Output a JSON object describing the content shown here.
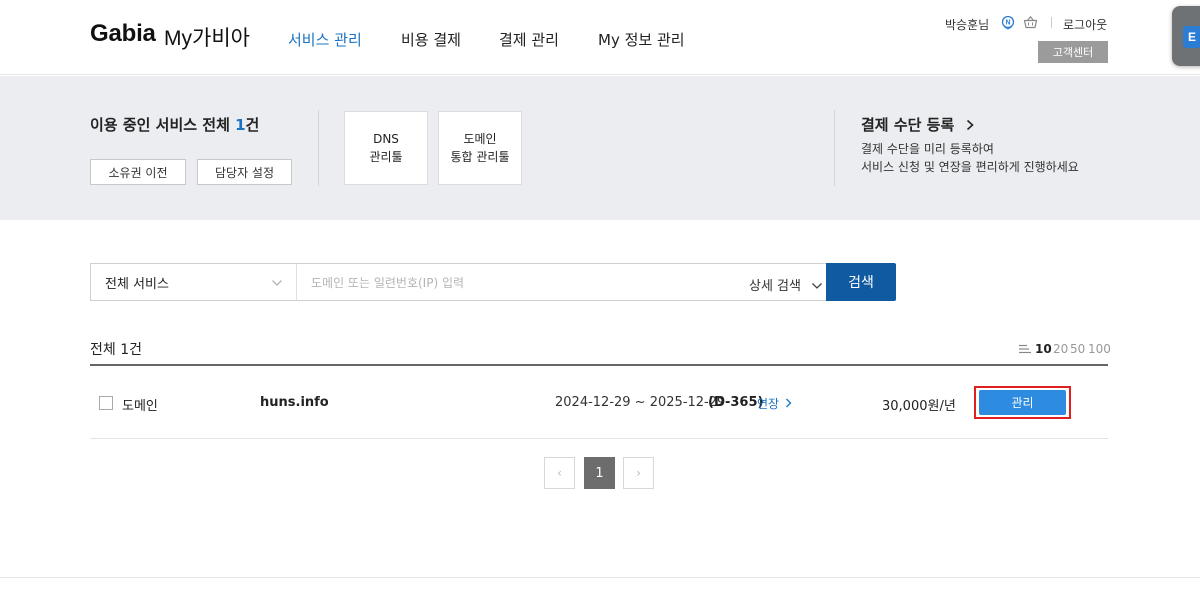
{
  "header": {
    "logo": "Gabia",
    "logo_sub": "My가비아",
    "nav": [
      {
        "label": "서비스 관리",
        "active": true
      },
      {
        "label": "비용 결제",
        "active": false
      },
      {
        "label": "결제 관리",
        "active": false
      },
      {
        "label": "My 정보 관리",
        "active": false
      }
    ],
    "user_name": "박승훈님",
    "notification_icon": "n-badge-icon",
    "cart_icon": "basket-icon",
    "logout_label": "로그아웃",
    "support_label": "고객센터",
    "side_app_letter": "E"
  },
  "summary": {
    "title_prefix": "이용 중인 서비스 전체 ",
    "title_count": "1",
    "title_suffix": "건",
    "transfer_button": "소유권 이전",
    "manager_button": "담당자 설정",
    "tools": [
      {
        "line1": "DNS",
        "line2": "관리툴"
      },
      {
        "line1": "도메인",
        "line2": "통합 관리툴"
      }
    ],
    "payment_title": "결제 수단 등록",
    "payment_desc1": "결제 수단을 미리 등록하여",
    "payment_desc2": "서비스 신청 및 연장을 편리하게 진행하세요"
  },
  "search": {
    "select_value": "전체 서비스",
    "placeholder": "도메인 또는 일련번호(IP) 입력",
    "detail_label": "상세 검색",
    "button_label": "검색"
  },
  "list": {
    "total_label": "전체 1건",
    "page_sizes": [
      {
        "label": "10",
        "active": true
      },
      {
        "label": "20",
        "active": false
      },
      {
        "label": "50",
        "active": false
      },
      {
        "label": "100",
        "active": false
      }
    ],
    "rows": [
      {
        "type": "도메인",
        "domain": "huns.info",
        "period": "2024-12-29 ~ 2025-12-29",
        "dday": "(D-365)",
        "extend": "연장",
        "price": "30,000원/년",
        "manage": "관리"
      }
    ]
  },
  "pagination": {
    "prev": "‹",
    "current": "1",
    "next": "›"
  }
}
